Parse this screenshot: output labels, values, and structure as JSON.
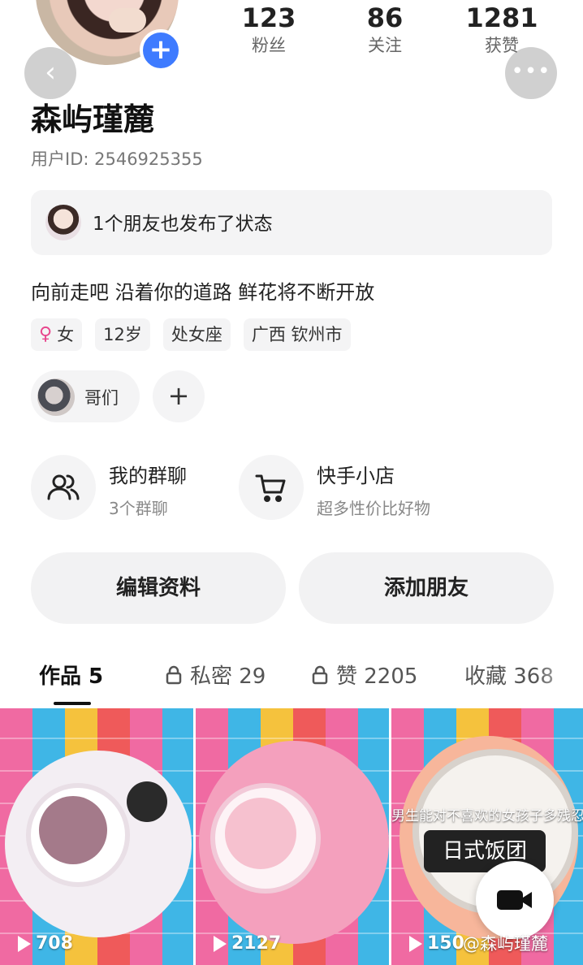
{
  "profile": {
    "name": "森屿瑾麓",
    "user_id": "用户ID: 2546925355",
    "bio": "向前走吧 沿着你的道路 鲜花将不断开放"
  },
  "stats": [
    {
      "value": "123",
      "label": "粉丝"
    },
    {
      "value": "86",
      "label": "关注"
    },
    {
      "value": "1281",
      "label": "获赞"
    }
  ],
  "friend_card": {
    "text": "1个朋友也发布了状态"
  },
  "tags": {
    "gender_symbol": "♀",
    "gender": "女",
    "age": "12岁",
    "zodiac": "处女座",
    "location": "广西 钦州市"
  },
  "group_chip": {
    "label": "哥们",
    "add_symbol": "+"
  },
  "features": [
    {
      "title": "我的群聊",
      "subtitle": "3个群聊",
      "icon": "group-chat-icon"
    },
    {
      "title": "快手小店",
      "subtitle": "超多性价比好物",
      "icon": "cart-icon"
    }
  ],
  "actions": {
    "edit": "编辑资料",
    "add_friend": "添加朋友"
  },
  "tabs": [
    {
      "label": "作品 5",
      "active": true
    },
    {
      "label": "私密 29",
      "locked": true
    },
    {
      "label": "赞 2205",
      "locked": true
    },
    {
      "label": "收藏 368"
    }
  ],
  "videos": [
    {
      "plays": "708"
    },
    {
      "plays": "2127"
    },
    {
      "plays": "150"
    }
  ],
  "overlay": {
    "caption": "男生能对不喜欢的女孩子多残忍",
    "sign": "日式饭团",
    "watermark": "@森屿瑾麓"
  },
  "header": {
    "back": "‹",
    "more": "•••",
    "add": "+"
  },
  "colors": {
    "accent_blue": "#3e7bff",
    "female_pink": "#e8468d"
  }
}
